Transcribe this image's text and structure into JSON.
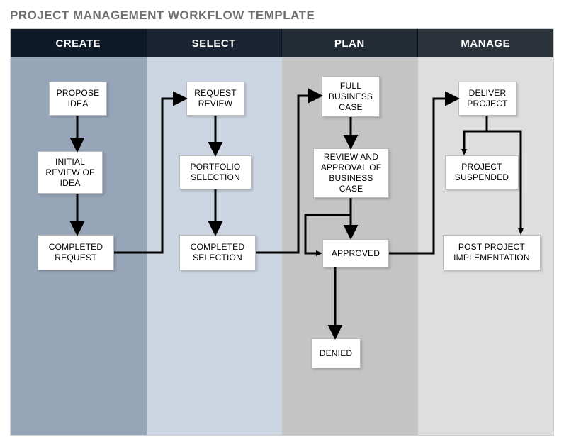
{
  "title": "PROJECT MANAGEMENT WORKFLOW TEMPLATE",
  "columns": {
    "create": {
      "label": "CREATE"
    },
    "select": {
      "label": "SELECT"
    },
    "plan": {
      "label": "PLAN"
    },
    "manage": {
      "label": "MANAGE"
    }
  },
  "nodes": {
    "propose_idea": "PROPOSE IDEA",
    "initial_review": "INITIAL REVIEW OF IDEA",
    "completed_request": "COMPLETED REQUEST",
    "request_review": "REQUEST REVIEW",
    "portfolio_selection": "PORTFOLIO SELECTION",
    "completed_selection": "COMPLETED SELECTION",
    "full_business_case": "FULL BUSINESS CASE",
    "review_approval": "REVIEW AND APPROVAL OF BUSINESS CASE",
    "approved": "APPROVED",
    "denied": "DENIED",
    "deliver_project": "DELIVER PROJECT",
    "project_suspended": "PROJECT SUSPENDED",
    "post_project_impl": "POST PROJECT IMPLEMENTATION"
  }
}
